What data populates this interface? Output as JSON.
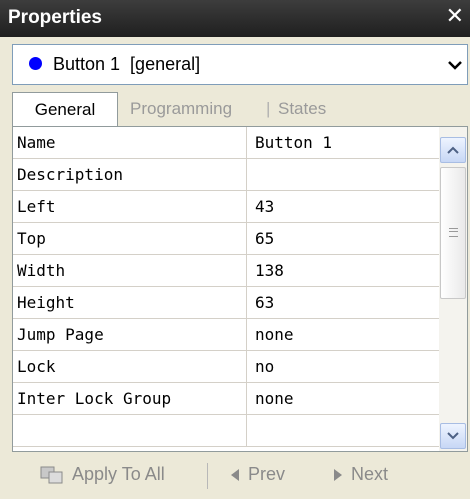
{
  "window": {
    "title": "Properties"
  },
  "object_selector": {
    "value": "Button 1  [general]"
  },
  "tabs": [
    {
      "label": "General",
      "active": true
    },
    {
      "label": "Programming",
      "active": false
    },
    {
      "label": "States",
      "active": false
    }
  ],
  "tab_separator": "|",
  "properties": [
    {
      "name": "Name",
      "value": "Button 1"
    },
    {
      "name": "Description",
      "value": ""
    },
    {
      "name": "Left",
      "value": "43"
    },
    {
      "name": "Top",
      "value": "65"
    },
    {
      "name": "Width",
      "value": "138"
    },
    {
      "name": "Height",
      "value": "63"
    },
    {
      "name": "Jump Page",
      "value": "none"
    },
    {
      "name": "Lock",
      "value": "no"
    },
    {
      "name": "Inter Lock Group",
      "value": "none"
    },
    {
      "name": "",
      "value": ""
    }
  ],
  "footer": {
    "apply_label": "Apply To All",
    "prev_label": "Prev",
    "next_label": "Next"
  },
  "icons": {
    "close": "close-icon",
    "dropdown": "chevron-down-icon",
    "object": "object-dot-icon",
    "apply": "apply-all-icon",
    "prev": "triangle-left-icon",
    "next": "triangle-right-icon",
    "scroll_up": "arrow-up-icon",
    "scroll_down": "arrow-down-icon"
  },
  "colors": {
    "titlebar": "#2a2a2a",
    "object_dot": "#0000ff",
    "disabled_text": "#8a8a8a",
    "panel_bg": "#ece9d8"
  }
}
